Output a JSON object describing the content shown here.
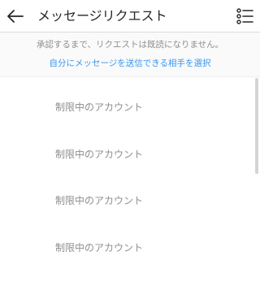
{
  "header": {
    "title": "メッセージリクエスト",
    "back_icon": "back-arrow-icon",
    "menu_icon": "list-menu-icon"
  },
  "info": {
    "text": "承認するまで、リクエストは既読になりません。",
    "link": "自分にメッセージを送信できる相手を選択"
  },
  "requests": [
    {
      "label": "制限中のアカウント"
    },
    {
      "label": "制限中のアカウント"
    },
    {
      "label": "制限中のアカウント"
    },
    {
      "label": "制限中のアカウント"
    }
  ],
  "colors": {
    "link": "#3897f0",
    "secondary_text": "#8e8e8e",
    "primary_text": "#262626",
    "info_background": "#fafafa"
  }
}
